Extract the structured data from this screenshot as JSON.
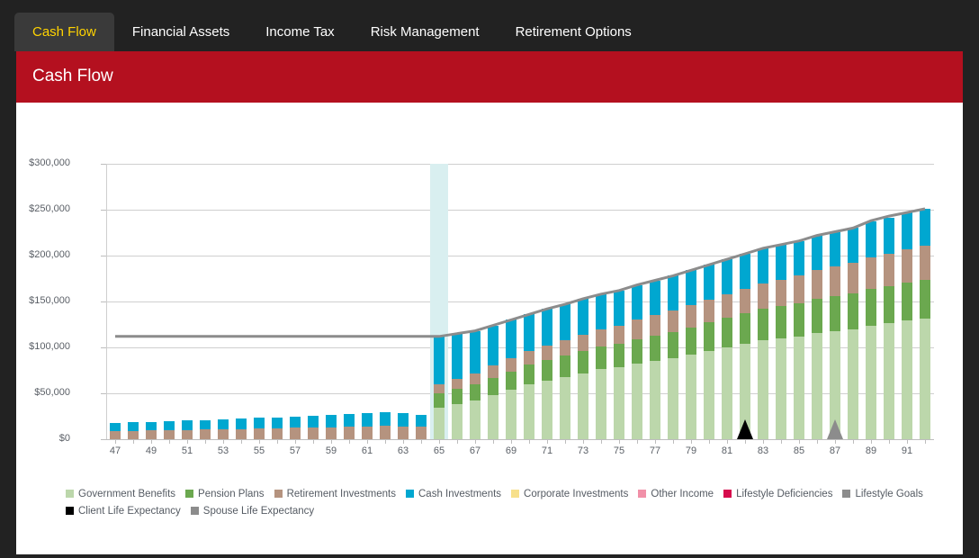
{
  "window": {
    "frame_color": "#222222",
    "panel_bg": "#ffffff"
  },
  "tabs": [
    {
      "label": "Cash Flow",
      "active": true
    },
    {
      "label": "Financial Assets",
      "active": false
    },
    {
      "label": "Income Tax",
      "active": false
    },
    {
      "label": "Risk Management",
      "active": false
    },
    {
      "label": "Retirement Options",
      "active": false
    }
  ],
  "header": {
    "title": "Cash Flow",
    "bg_color": "#b4101f",
    "text_color": "#ffffff",
    "active_tab_text_color": "#ffd300"
  },
  "chart_data": {
    "type": "bar",
    "stacked": true,
    "title": "",
    "xlabel": "",
    "ylabel": "",
    "ylim": [
      0,
      300000
    ],
    "ytick_labels": [
      "$0",
      "$50,000",
      "$100,000",
      "$150,000",
      "$200,000",
      "$250,000",
      "$300,000"
    ],
    "ytick_values": [
      0,
      50000,
      100000,
      150000,
      200000,
      250000,
      300000
    ],
    "grid": true,
    "legend_position": "bottom",
    "categories": [
      47,
      48,
      49,
      50,
      51,
      52,
      53,
      54,
      55,
      56,
      57,
      58,
      59,
      60,
      61,
      62,
      63,
      64,
      65,
      66,
      67,
      68,
      69,
      70,
      71,
      72,
      73,
      74,
      75,
      76,
      77,
      78,
      79,
      80,
      81,
      82,
      83,
      84,
      85,
      86,
      87,
      88,
      89,
      90,
      91,
      92
    ],
    "xtick_labels": [
      "47",
      "49",
      "51",
      "53",
      "55",
      "57",
      "59",
      "61",
      "63",
      "65",
      "67",
      "69",
      "71",
      "73",
      "75",
      "77",
      "79",
      "81",
      "83",
      "85",
      "87",
      "89",
      "91"
    ],
    "series": [
      {
        "name": "Government Benefits",
        "color": "#bcd7ab",
        "values": [
          0,
          0,
          0,
          0,
          0,
          0,
          0,
          0,
          0,
          0,
          0,
          0,
          0,
          0,
          0,
          0,
          0,
          0,
          34000,
          38000,
          42000,
          48000,
          54000,
          60000,
          64000,
          68000,
          72000,
          76000,
          78000,
          82000,
          85000,
          88000,
          92000,
          96000,
          100000,
          104000,
          108000,
          110000,
          112000,
          116000,
          118000,
          120000,
          124000,
          126000,
          129000,
          131000
        ]
      },
      {
        "name": "Pension Plans",
        "color": "#6ba84f",
        "values": [
          0,
          0,
          0,
          0,
          0,
          0,
          0,
          0,
          0,
          0,
          0,
          0,
          0,
          0,
          0,
          0,
          0,
          0,
          16000,
          17000,
          18000,
          19000,
          20000,
          21000,
          22000,
          23000,
          24000,
          25000,
          26000,
          27000,
          28000,
          29000,
          30000,
          31000,
          32000,
          33000,
          34000,
          35000,
          36000,
          37000,
          38000,
          39000,
          40000,
          41000,
          42000,
          43000
        ]
      },
      {
        "name": "Retirement Investments",
        "color": "#b5937f",
        "values": [
          9000,
          9200,
          9500,
          9800,
          10200,
          10500,
          10800,
          11200,
          11600,
          12000,
          12400,
          12800,
          13200,
          13600,
          14000,
          14500,
          14000,
          13500,
          10000,
          11000,
          12000,
          13000,
          14000,
          15000,
          16000,
          17000,
          18000,
          19000,
          20000,
          21000,
          22000,
          23000,
          24000,
          25000,
          26000,
          27000,
          28000,
          29000,
          30000,
          31000,
          32000,
          33000,
          34000,
          35000,
          36000,
          37000
        ]
      },
      {
        "name": "Cash Investments",
        "color": "#00a7d0",
        "values": [
          9000,
          9200,
          9500,
          9800,
          10200,
          10500,
          10800,
          11200,
          11600,
          12000,
          12400,
          12800,
          13200,
          13600,
          14000,
          14500,
          14000,
          13000,
          52000,
          49000,
          46000,
          44000,
          42000,
          40000,
          40000,
          39000,
          39000,
          38000,
          38000,
          38000,
          38000,
          38000,
          38000,
          38000,
          38000,
          38000,
          38000,
          38000,
          38000,
          38000,
          38000,
          38000,
          39000,
          39000,
          40000,
          40000
        ]
      },
      {
        "name": "Corporate Investments",
        "color": "#f7e08b",
        "values": []
      },
      {
        "name": "Other Income",
        "color": "#f190a8",
        "values": []
      },
      {
        "name": "Lifestyle Deficiencies",
        "color": "#d60b4c",
        "values": []
      }
    ],
    "overlay_line": {
      "name": "Lifestyle Goals",
      "color": "#8c8c8c",
      "values": [
        112000,
        112000,
        112000,
        112000,
        112000,
        112000,
        112000,
        112000,
        112000,
        112000,
        112000,
        112000,
        112000,
        112000,
        112000,
        112000,
        112000,
        112000,
        112000,
        115000,
        118000,
        124000,
        130000,
        136000,
        142000,
        147000,
        153000,
        158000,
        162000,
        168000,
        173000,
        178000,
        184000,
        190000,
        196000,
        202000,
        208000,
        212000,
        216000,
        222000,
        226000,
        230000,
        238000,
        243000,
        247000,
        251000
      ]
    },
    "highlight_band": {
      "category": 65,
      "color": "#d9eff0"
    },
    "markers": [
      {
        "name": "Client Life Expectancy",
        "category": 82,
        "color": "#000000"
      },
      {
        "name": "Spouse Life Expectancy",
        "category": 87,
        "color": "#8c8c8c"
      }
    ]
  },
  "legend": {
    "rows": [
      [
        {
          "label": "Government Benefits",
          "color": "#bcd7ab"
        },
        {
          "label": "Pension Plans",
          "color": "#6ba84f"
        },
        {
          "label": "Retirement Investments",
          "color": "#b5937f"
        },
        {
          "label": "Cash Investments",
          "color": "#00a7d0"
        },
        {
          "label": "Corporate Investments",
          "color": "#f7e08b"
        },
        {
          "label": "Other Income",
          "color": "#f190a8"
        },
        {
          "label": "Lifestyle Deficiencies",
          "color": "#d60b4c"
        },
        {
          "label": "Lifestyle Goals",
          "color": "#8c8c8c"
        }
      ],
      [
        {
          "label": "Client Life Expectancy",
          "color": "#000000"
        },
        {
          "label": "Spouse Life Expectancy",
          "color": "#8c8c8c"
        }
      ]
    ]
  }
}
